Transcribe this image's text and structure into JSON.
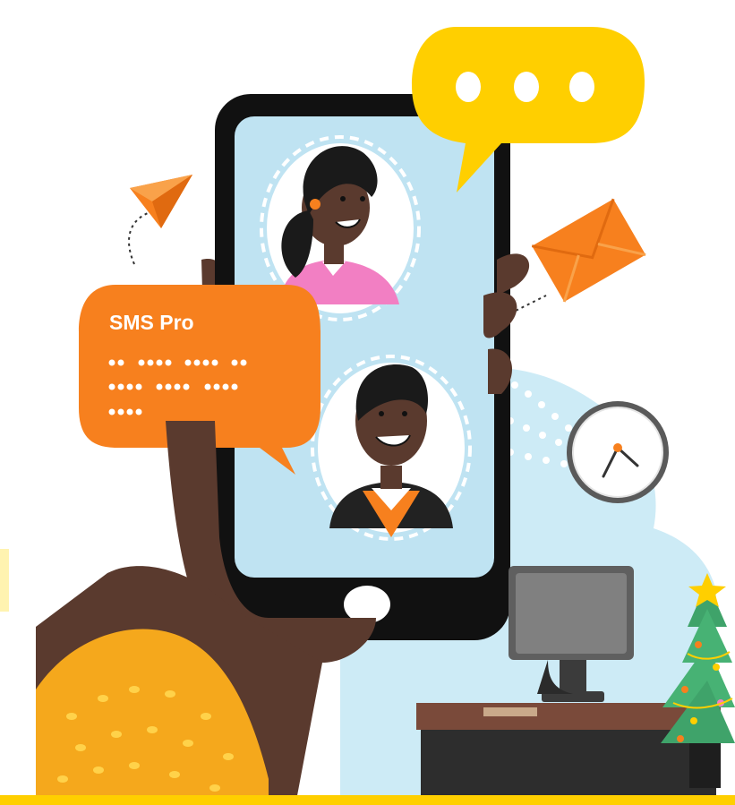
{
  "illustration": {
    "sms_bubble": {
      "title": "SMS Pro",
      "placeholder_dot_groups": [
        [
          2,
          4,
          4,
          2
        ],
        [
          4,
          4,
          4
        ],
        [
          4
        ]
      ]
    },
    "typing_bubble": {
      "dots": 3
    },
    "clock": {
      "icon": "clock-icon"
    },
    "icons": [
      "paper-plane-icon",
      "envelope-icon",
      "clock-icon",
      "christmas-tree-icon",
      "monitor-icon"
    ],
    "colors": {
      "accent_yellow": "#FFCF00",
      "accent_orange": "#F7801E",
      "phone_body": "#111111",
      "screen_bg": "#BFE3F2",
      "skin": "#5A3A2E",
      "sleeve": "#F5A81C",
      "woman_shirt": "#F27FC3"
    }
  }
}
